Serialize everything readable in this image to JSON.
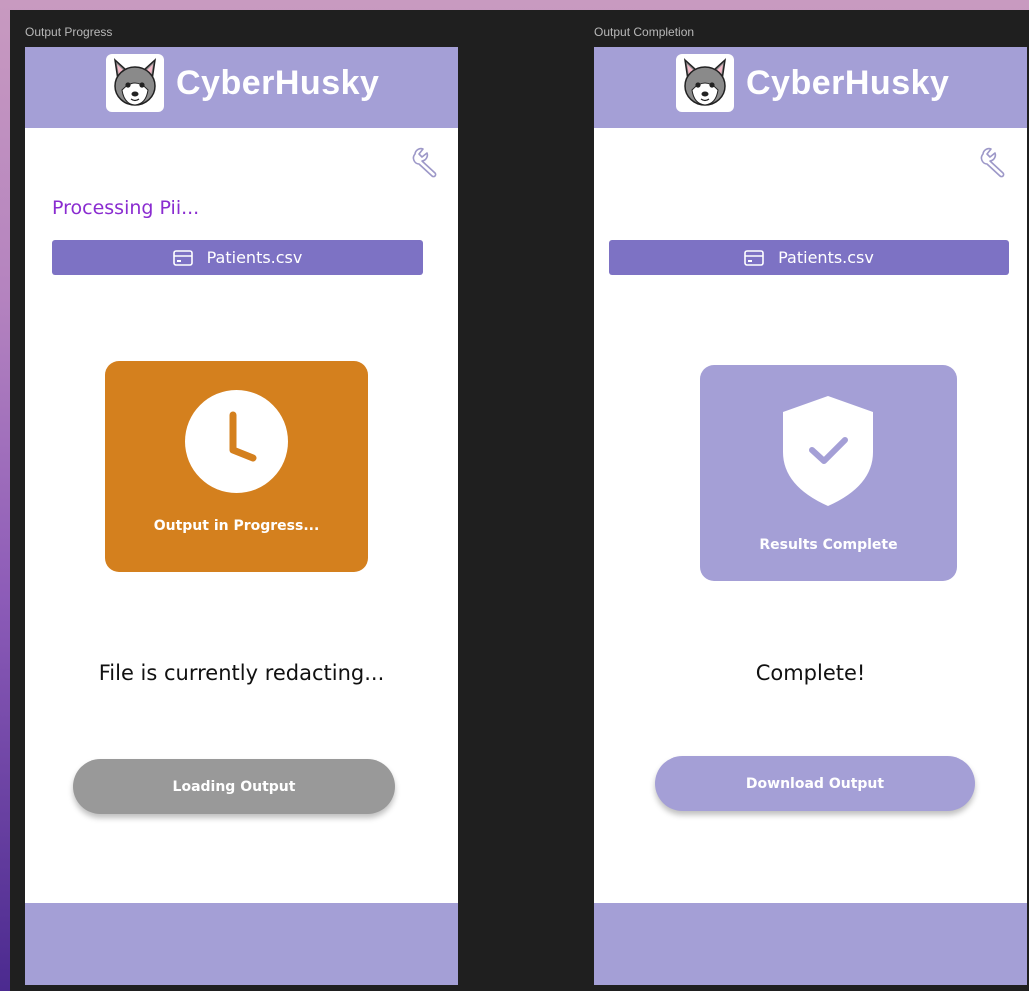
{
  "left_frame": {
    "frame_label": "Output Progress",
    "app_name": "CyberHusky",
    "processing_text": "Processing Pii...",
    "file_name": "Patients.csv",
    "status_card_text": "Output in Progress...",
    "message": "File is currently redacting...",
    "button_label": "Loading Output"
  },
  "right_frame": {
    "frame_label": "Output Completion",
    "app_name": "CyberHusky",
    "file_name": "Patients.csv",
    "status_card_text": "Results Complete",
    "message": "Complete!",
    "button_label": "Download Output"
  },
  "icons": {
    "logo": "husky-logo-icon",
    "settings": "wrench-icon",
    "file": "credit-card-icon",
    "progress": "clock-icon",
    "complete": "shield-check-icon"
  },
  "colors": {
    "header": "#a49fd6",
    "file_bar": "#7d72c4",
    "processing_text": "#8a2cd0",
    "progress_card": "#d4801e",
    "complete_card": "#a49fd6",
    "loading_button": "#999999",
    "download_button": "#a49fd6"
  }
}
